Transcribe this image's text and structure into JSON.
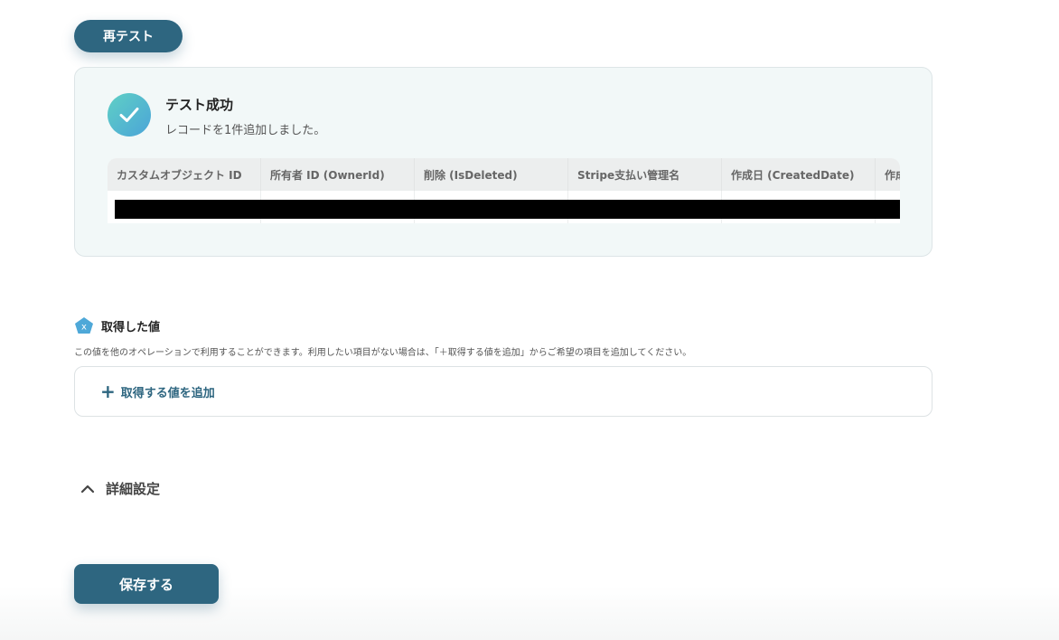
{
  "retest_button": "再テスト",
  "result": {
    "title": "テスト成功",
    "subtitle": "レコードを1件追加しました。",
    "columns": [
      "カスタムオブジェクト ID",
      "所有者 ID (OwnerId)",
      "削除 (IsDeleted)",
      "Stripe支払い管理名",
      "作成日 (CreatedDate)",
      "作成"
    ]
  },
  "fetched": {
    "icon": "variable-x-icon",
    "title": "取得した値",
    "description": "この値を他のオペレーションで利用することができます。利用したい項目がない場合は、「＋取得する値を追加」からご希望の項目を追加してください。",
    "add_label": "取得する値を追加"
  },
  "details_label": "詳細設定",
  "save_button": "保存する",
  "colors": {
    "accent": "#2e6680",
    "success_start": "#5fd0c5",
    "success_end": "#4ba4d8"
  }
}
